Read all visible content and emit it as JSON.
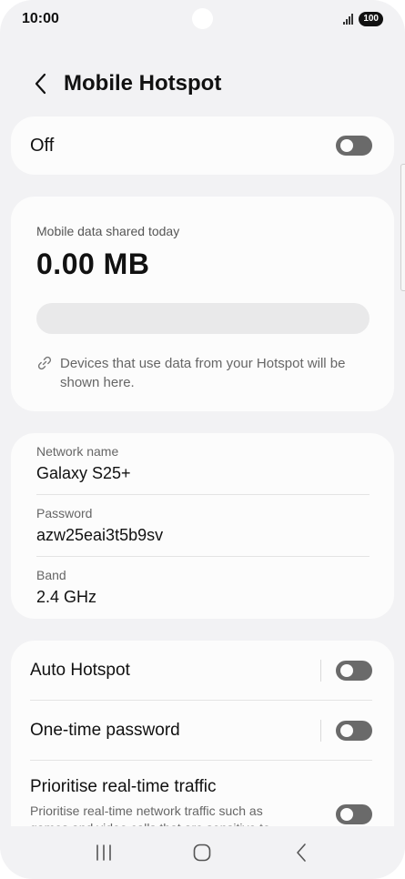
{
  "status_bar": {
    "time": "10:00",
    "battery": "100",
    "signal_icon": "signal-icon"
  },
  "header": {
    "back_icon": "chevron-left-icon",
    "title": "Mobile Hotspot"
  },
  "hotspot_toggle": {
    "label": "Off",
    "on": false
  },
  "data_usage": {
    "caption": "Mobile data shared today",
    "value": "0.00 MB",
    "fill_fraction": 0,
    "note_icon": "link-icon",
    "note": "Devices that use data from your Hotspot will be shown here."
  },
  "network": {
    "fields": [
      {
        "label": "Network name",
        "value": "Galaxy S25+"
      },
      {
        "label": "Password",
        "value": "azw25eai3t5b9sv"
      },
      {
        "label": "Band",
        "value": "2.4 GHz"
      }
    ]
  },
  "settings": {
    "auto_hotspot": {
      "label": "Auto Hotspot",
      "on": false
    },
    "one_time_password": {
      "label": "One-time password",
      "on": false
    },
    "prioritise": {
      "label": "Prioritise real-time traffic",
      "sub": "Prioritise real-time network traffic such as games and video calls that are sensitive to",
      "on": false
    }
  },
  "nav": {
    "recents_icon": "recents-icon",
    "home_icon": "home-icon",
    "back_icon": "back-icon"
  },
  "colors": {
    "background": "#f2f2f4",
    "card": "#fcfcfc",
    "toggle_off": "#6a6a6a"
  }
}
